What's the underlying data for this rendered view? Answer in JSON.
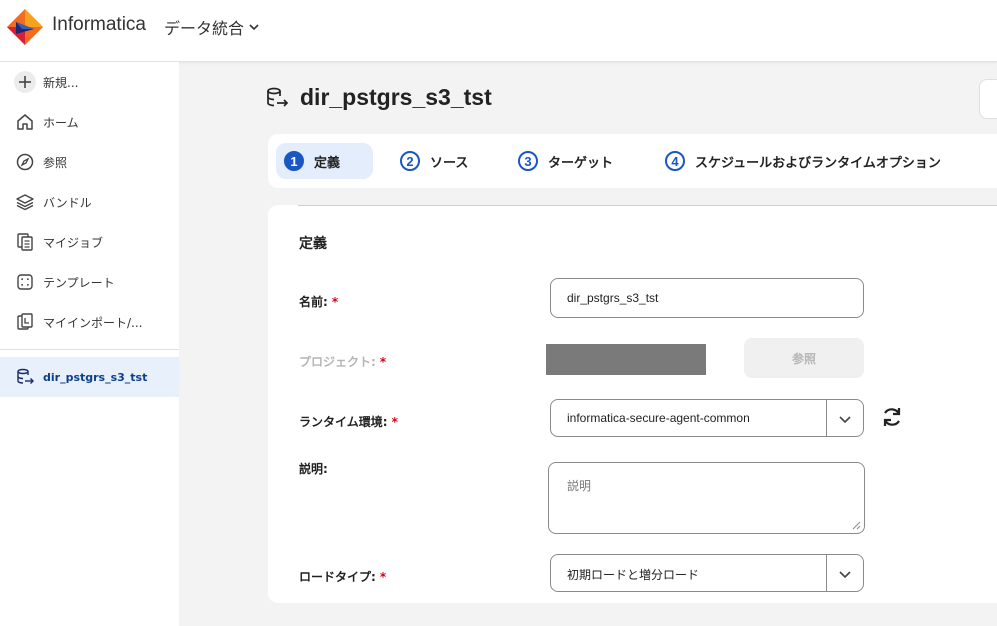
{
  "header": {
    "brand": "Informatica",
    "product": "データ統合",
    "colors": {
      "logo_orange": "#f26b21",
      "logo_red": "#d6203a",
      "logo_navy": "#1a2a6c"
    }
  },
  "sidebar": {
    "items": [
      {
        "label": "新規...",
        "icon": "plus-icon"
      },
      {
        "label": "ホーム",
        "icon": "home-icon"
      },
      {
        "label": "参照",
        "icon": "compass-icon"
      },
      {
        "label": "バンドル",
        "icon": "layers-icon"
      },
      {
        "label": "マイジョブ",
        "icon": "jobs-icon"
      },
      {
        "label": "テンプレート",
        "icon": "template-icon"
      },
      {
        "label": "マイインポート/...",
        "icon": "import-icon"
      }
    ],
    "open_task": {
      "label": "dir_pstgrs_s3_tst",
      "icon": "replication-task-icon"
    }
  },
  "page": {
    "title": "dir_pstgrs_s3_tst"
  },
  "steps": [
    {
      "num": "1",
      "label": "定義",
      "active": true
    },
    {
      "num": "2",
      "label": "ソース",
      "active": false
    },
    {
      "num": "3",
      "label": "ターゲット",
      "active": false
    },
    {
      "num": "4",
      "label": "スケジュールおよびランタイムオプション",
      "active": false
    }
  ],
  "form": {
    "section_title": "定義",
    "required_mark": "*",
    "name": {
      "label": "名前:",
      "value": "dir_pstgrs_s3_tst"
    },
    "project": {
      "label": "プロジェクト:",
      "browse_label": "参照"
    },
    "runtime": {
      "label": "ランタイム環境:",
      "value": "informatica-secure-agent-common"
    },
    "description": {
      "label": "説明:",
      "placeholder": "説明"
    },
    "load_type": {
      "label": "ロードタイプ:",
      "value": "初期ロードと増分ロード"
    }
  },
  "colors": {
    "accent": "#1a56c4",
    "active_step_bg": "#e3edfb",
    "required": "#d0021b",
    "sidebar_active_bg": "#e8f0fb"
  }
}
